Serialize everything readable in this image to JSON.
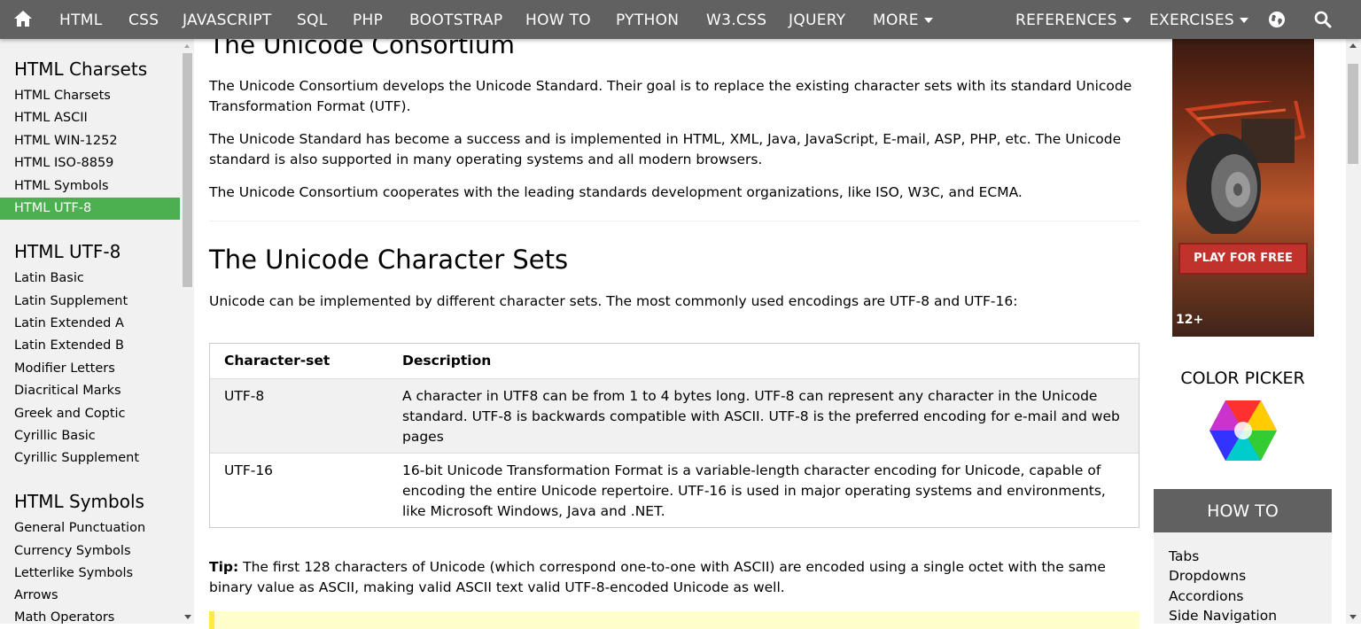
{
  "nav": {
    "items": [
      "HTML",
      "CSS",
      "JAVASCRIPT",
      "SQL",
      "PHP",
      "BOOTSTRAP",
      "HOW TO",
      "PYTHON",
      "W3.CSS",
      "JQUERY",
      "MORE"
    ],
    "references": "REFERENCES",
    "exercises": "EXERCISES",
    "icons": [
      "home-icon",
      "globe-icon",
      "search-icon"
    ]
  },
  "sidebar": {
    "sections": [
      {
        "heading": "HTML Charsets",
        "items": [
          "HTML Charsets",
          "HTML ASCII",
          "HTML WIN-1252",
          "HTML ISO-8859",
          "HTML Symbols",
          "HTML UTF-8"
        ]
      },
      {
        "heading": "HTML UTF-8",
        "items": [
          "Latin Basic",
          "Latin Supplement",
          "Latin Extended A",
          "Latin Extended B",
          "Modifier Letters",
          "Diacritical Marks",
          "Greek and Coptic",
          "Cyrillic Basic",
          "Cyrillic Supplement"
        ]
      },
      {
        "heading": "HTML Symbols",
        "items": [
          "General Punctuation",
          "Currency Symbols",
          "Letterlike Symbols",
          "Arrows",
          "Math Operators"
        ]
      }
    ],
    "active_item": "HTML UTF-8",
    "accent_color": "#4CAF50"
  },
  "main": {
    "consortium_title": "The Unicode Consortium",
    "p1": "The Unicode Consortium develops the Unicode Standard. Their goal is to replace the existing character sets with its standard Unicode Transformation Format (UTF).",
    "p2": "The Unicode Standard has become a success and is implemented in HTML, XML, Java, JavaScript, E-mail, ASP, PHP, etc. The Unicode standard is also supported in many operating systems and all modern browsers.",
    "p3": "The Unicode Consortium cooperates with the leading standards development organizations, like ISO, W3C, and ECMA.",
    "sets_title": "The Unicode Character Sets",
    "sets_intro": "Unicode can be implemented by different character sets. The most commonly used encodings are UTF-8 and UTF-16:",
    "table": {
      "headers": [
        "Character-set",
        "Description"
      ],
      "rows": [
        [
          "UTF-8",
          "A character in UTF8 can be from 1 to 4 bytes long. UTF-8 can represent any character in the Unicode standard. UTF-8 is backwards compatible with ASCII. UTF-8 is the preferred encoding for e-mail and web pages"
        ],
        [
          "UTF-16",
          "16-bit Unicode Transformation Format is a variable-length character encoding for Unicode, capable of encoding the entire Unicode repertoire. UTF-16 is used in major operating systems and environments, like Microsoft Windows, Java and .NET."
        ]
      ]
    },
    "tip_label": "Tip:",
    "tip_text": " The first 128 characters of Unicode (which correspond one-to-one with ASCII) are encoded using a single octet with the same binary value as ASCII, making valid ASCII text valid UTF-8-encoded Unicode as well."
  },
  "right": {
    "ad_button": "PLAY FOR FREE",
    "ad_rating": "12+",
    "color_picker_label": "COLOR PICKER",
    "howto_title": "HOW TO",
    "howto_items": [
      "Tabs",
      "Dropdowns",
      "Accordions",
      "Side Navigation"
    ]
  },
  "colors": {
    "nav_bg": "#616161",
    "sidebar_bg": "#f1f1f1",
    "active_green": "#4CAF50",
    "note_yellow": "#ffffcc"
  }
}
